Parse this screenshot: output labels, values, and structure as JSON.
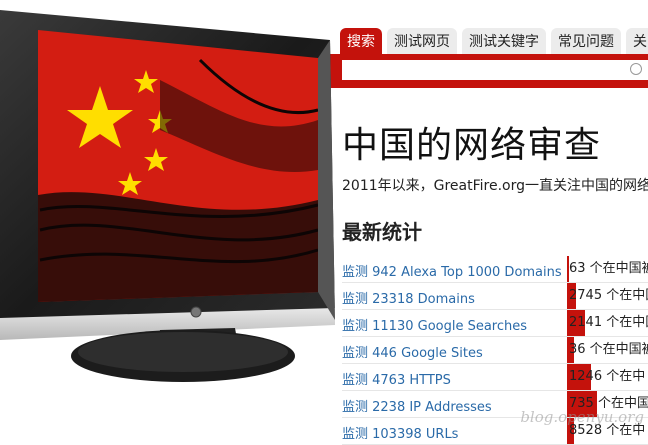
{
  "tabs": [
    "搜索",
    "测试网页",
    "测试关键字",
    "常见问题",
    "关"
  ],
  "search": {
    "placeholder": ""
  },
  "page_title": "中国的网络审查",
  "intro": "2011年以来，GreatFire.org一直关注中国的网络",
  "section_title": "最新统计",
  "stats": [
    {
      "label": "监测 942 Alexa Top 1000 Domains",
      "count": "63 个在中国被",
      "fill": 0.02
    },
    {
      "label": "监测 23318 Domains",
      "count": "2745 个在中国",
      "fill": 0.1
    },
    {
      "label": "监测 11130 Google Searches",
      "count": "2141 个在中国",
      "fill": 0.2
    },
    {
      "label": "监测 446 Google Sites",
      "count": "36 个在中国被",
      "fill": 0.08
    },
    {
      "label": "监测 4763 HTTPS",
      "count": "1246 个在中",
      "fill": 0.27
    },
    {
      "label": "监测 2238 IP Addresses",
      "count": "735 个在中国",
      "fill": 0.33
    },
    {
      "label": "监测 103398 URLs",
      "count": "8528 个在中",
      "fill": 0.08
    }
  ],
  "watermark": "blog.openyu.org",
  "colors": {
    "accent": "#c4120c",
    "link": "#2a6aa8"
  }
}
